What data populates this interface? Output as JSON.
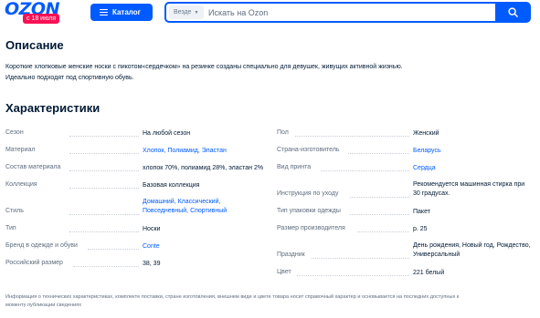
{
  "header": {
    "logo_text": "OZON",
    "logo_badge": "с 18 июля",
    "catalog_label": "Каталог",
    "search_scope": "Везде",
    "search_placeholder": "Искать на Ozon"
  },
  "description": {
    "title": "Описание",
    "line1": "Короткие хлопковые женские носки с пикотом«сердечком» на резинке созданы специально для девушек, живущих активной жизнью.",
    "line2": "Идеально подходят под спортивную обувь."
  },
  "characteristics": {
    "title": "Характеристики",
    "left": [
      {
        "label": "Сезон",
        "value": "На любой сезон",
        "link": false
      },
      {
        "label": "Материал",
        "value": "Хлопок, Полиамид, Эластан",
        "link": true
      },
      {
        "label": "Состав материала",
        "value": "хлопок 70%, полиамид 28%, эластан 2%",
        "link": false
      },
      {
        "label": "Коллекция",
        "value": "Базовая коллекция",
        "link": false
      },
      {
        "label": "Стиль",
        "value_line1": "Домашний, Классический,",
        "value_line2": "Повседневный, Спортивный",
        "link": true
      },
      {
        "label": "Тип",
        "value": "Носки",
        "link": false
      },
      {
        "label": "Бренд в одежде и обуви",
        "value": "Conte",
        "link": true
      },
      {
        "label": "Российский размер",
        "value": "38, 39",
        "link": false
      }
    ],
    "right": [
      {
        "label": "Пол",
        "value": "Женский",
        "link": false
      },
      {
        "label": "Страна-изготовитель",
        "value": "Беларусь",
        "link": true
      },
      {
        "label": "Вид принта",
        "value": "Сердца",
        "link": true
      },
      {
        "label": "Инструкция по уходу",
        "value_line1": "Рекомендуется машинная стирка при",
        "value_line2": "30 градусах.",
        "link": false
      },
      {
        "label": "Тип упаковки одежды",
        "value": "Пакет",
        "link": false
      },
      {
        "label": "Размер производителя",
        "value": "р. 25",
        "link": false
      },
      {
        "label": "Праздник",
        "value_line1": "День рождения, Новый год, Рождество,",
        "value_line2": "Универсальный",
        "link": false
      },
      {
        "label": "Цвет",
        "value": "221 белый",
        "link": false
      }
    ]
  },
  "footer": {
    "note_line1": "Информация о технических характеристиках, комплекте поставки, стране изготовления, внешнем виде и цвете товара носит справочный характер и основывается на последних доступных к",
    "note_line2": "моменту публикации сведениях"
  },
  "colors": {
    "brand": "#005bff",
    "badge": "#f91155",
    "text": "#001a34",
    "muted": "#5e6c7d"
  }
}
